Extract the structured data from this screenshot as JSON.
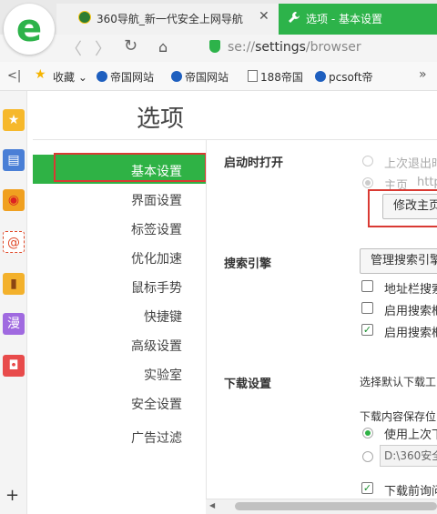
{
  "browser": {
    "tabs": [
      {
        "title": "360导航_新一代安全上网导航",
        "close_glyph": "✕",
        "icon": "360-logo-icon",
        "active": false
      },
      {
        "title": "选项 - 基本设置",
        "icon": "wrench-icon",
        "active": true
      }
    ],
    "logo_letter": "e",
    "nav": {
      "back": "〈",
      "forward": "〉",
      "refresh": "↻",
      "home": "⌂"
    },
    "url": {
      "scheme": "se://",
      "path": "settings",
      "rest": "/browser"
    },
    "bookmarks": {
      "toggle": "<|",
      "favorites_label": "收藏",
      "favorites_arrow": "⌄",
      "items": [
        "帝国网站",
        "帝国网站",
        "188帝国",
        "pcsoft帝"
      ],
      "more": "»"
    }
  },
  "appstrip": {
    "apps": [
      "favorites-icon",
      "news-icon",
      "weibo-icon",
      "mail-icon",
      "notebook-icon",
      "manga-icon",
      "game-icon"
    ],
    "mail_glyph": "@",
    "manga_glyph": "漫",
    "add_glyph": "+"
  },
  "settings": {
    "title": "选项",
    "nav_items": [
      "基本设置",
      "界面设置",
      "标签设置",
      "优化加速",
      "鼠标手势",
      "快捷键",
      "高级设置",
      "实验室",
      "安全设置",
      "广告过滤"
    ],
    "active_index": 0,
    "startup": {
      "title": "启动时打开",
      "option_last": "上次退出时",
      "option_home": "主页",
      "home_url": "http",
      "change_home_button": "修改主页"
    },
    "search": {
      "title": "搜索引擎",
      "manage_button": "管理搜索引擎",
      "address_bar_search": "地址栏搜索",
      "enable_1": "启用搜索框",
      "enable_2": "启用搜索框",
      "checked": [
        false,
        false,
        true
      ]
    },
    "download": {
      "title": "下载设置",
      "choose_default": "选择默认下载工",
      "save_location": "下载内容保存位",
      "use_last": "使用上次下",
      "path_value": "D:\\360安全",
      "ask_before": "下载前询问"
    }
  },
  "colors": {
    "accent": "#2fb245",
    "highlight_box": "#d93a33"
  }
}
